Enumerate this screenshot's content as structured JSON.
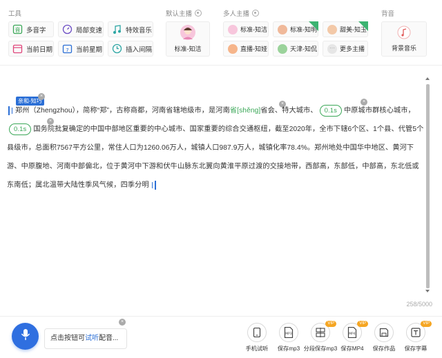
{
  "toolbar": {
    "tools_title": "工具",
    "tools": [
      {
        "label": "多音字",
        "icon": "polyphone-icon"
      },
      {
        "label": "局部变速",
        "icon": "speed-dial-icon"
      },
      {
        "label": "特效音乐",
        "icon": "music-note-icon"
      },
      {
        "label": "当前日期",
        "icon": "calendar-icon"
      },
      {
        "label": "当前星期",
        "icon": "week-calendar-icon"
      },
      {
        "label": "插入间隔",
        "icon": "pause-timer-icon"
      }
    ],
    "default_voice_title": "默认主播",
    "default_voice": {
      "label": "标准-知洁"
    },
    "multi_voice_title": "多人主播",
    "multi_voices": [
      {
        "label": "标准-知洁",
        "vip": false
      },
      {
        "label": "标准-知明",
        "vip": true
      },
      {
        "label": "甜美-知玉",
        "vip": true
      },
      {
        "label": "直播-知娅",
        "vip": false
      },
      {
        "label": "天津-知侃",
        "vip": false
      },
      {
        "label": "更多主播",
        "vip": false
      }
    ],
    "bgm_title": "背音",
    "bgm": {
      "label": "背景音乐"
    },
    "vip_text": "VIP"
  },
  "editor": {
    "speaker_tag": "亲和-知巧",
    "close_x": "×",
    "seg1": "郑州（Zhengzhou），简称“郑”，古称商都，河南省辖地级市，是河南",
    "pinyin": "省[shěng]",
    "seg2": "省会、特大城市、",
    "pause1": "0.1s",
    "seg3": "中原城市群核心城市，",
    "pause2": "0.1s",
    "seg4": "国务院批复确定的中国中部地区重要的中心城市、国家重要的综合交通枢纽，截至2020年，全市下辖6个区、1个县、代管5个县级市，总面积7567平方公里，常住人口为1260.06万人，城镇人口987.9万人，城镇化率78.4%。郑州地处中国华中地区、黄河下游、中原腹地、河南中部偏北，位于黄河中下游和伏牛山脉东北翼向黄淮平原过渡的交接地带，西部高，东部低，中部高，东北低或东南低；属北温带大陆性季风气候，四季分明",
    "char_count": "258/5000"
  },
  "footer": {
    "tip_prefix": "点击按钮可",
    "tip_highlight": "试听",
    "tip_suffix": "配音...",
    "actions": [
      {
        "label": "手机试听",
        "icon": "phone-icon",
        "vip": false
      },
      {
        "label": "保存mp3",
        "icon": "mp3-file-icon",
        "vip": false
      },
      {
        "label": "分段保存mp3",
        "icon": "split-save-icon",
        "vip": true
      },
      {
        "label": "保存MP4",
        "icon": "mp4-file-icon",
        "vip": true
      },
      {
        "label": "保存作品",
        "icon": "save-work-icon",
        "vip": false
      },
      {
        "label": "保存字幕",
        "icon": "subtitle-icon",
        "vip": true
      }
    ]
  },
  "colors": {
    "accent": "#2b6fd6",
    "green": "#3aa757",
    "vip_orange": "#f5a623"
  }
}
